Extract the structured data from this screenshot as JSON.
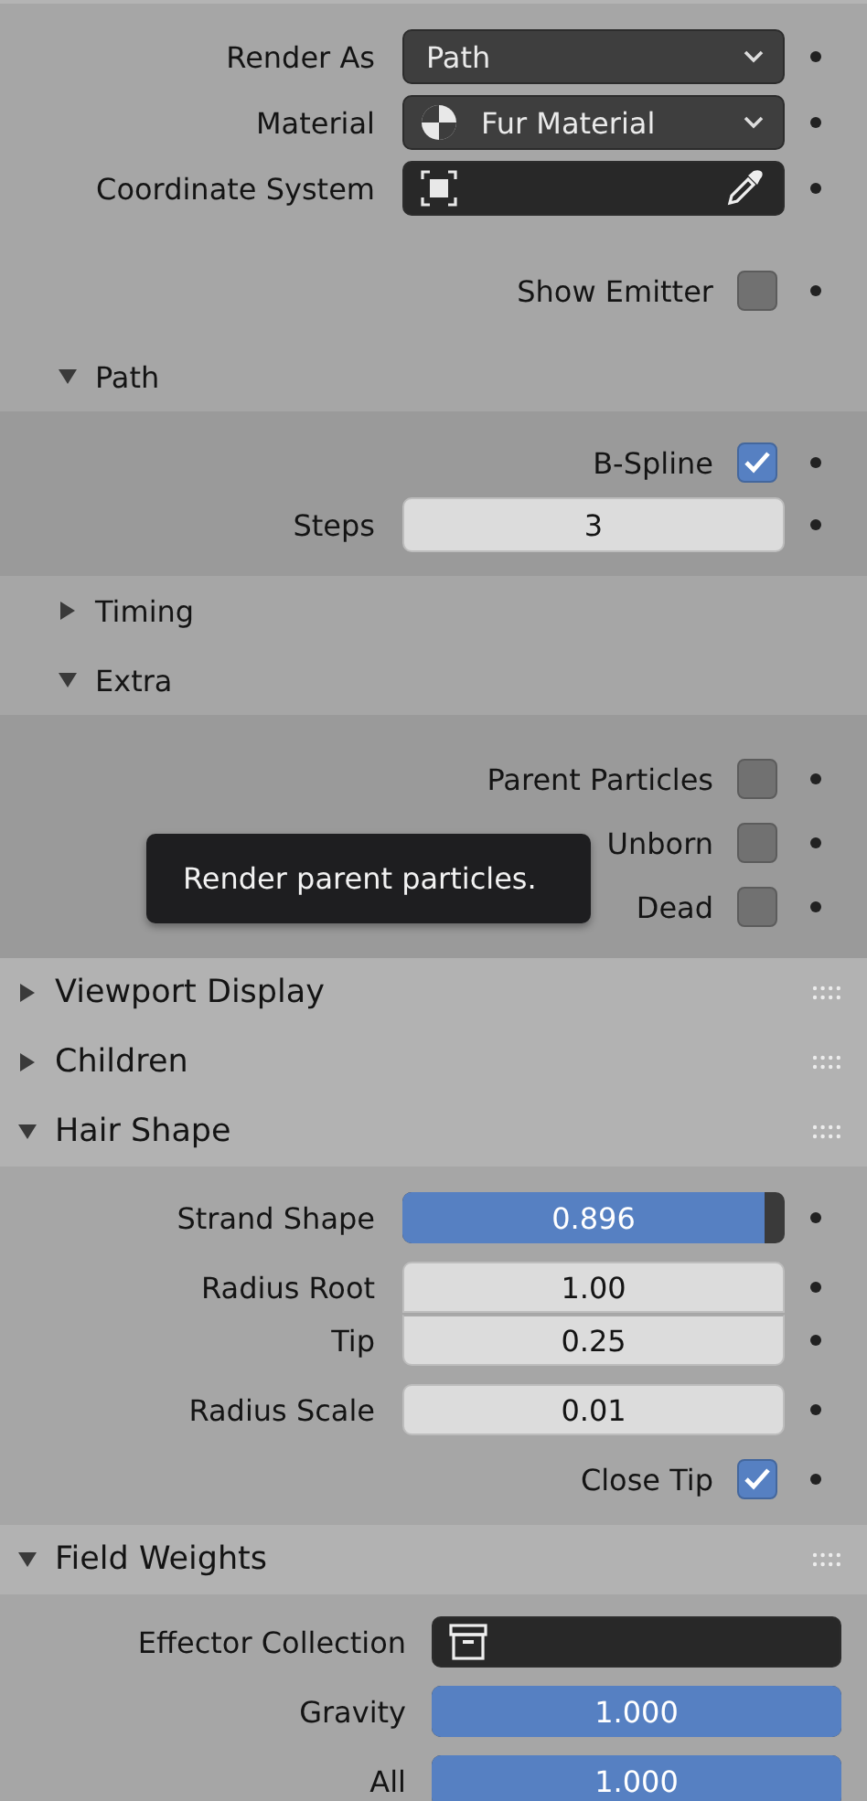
{
  "top_rows": [
    {
      "kind": "dropdown",
      "label": "Render As",
      "value": "Path"
    },
    {
      "kind": "material_dropdown",
      "label": "Material",
      "value": "Fur Material"
    },
    {
      "kind": "object_field",
      "label": "Coordinate System"
    }
  ],
  "show_emitter": {
    "kind": "checkbox",
    "label": "Show Emitter",
    "checked": false
  },
  "subpanels": [
    {
      "title": "Path",
      "expanded": true,
      "rows": [
        {
          "kind": "checkbox",
          "label": "B-Spline",
          "checked": true
        },
        {
          "kind": "number",
          "label": "Steps",
          "value": "3"
        }
      ]
    },
    {
      "title": "Timing",
      "expanded": false
    },
    {
      "title": "Extra",
      "expanded": true,
      "rows": [
        {
          "kind": "checkbox",
          "label": "Parent Particles",
          "checked": false
        },
        {
          "kind": "checkbox",
          "label": "Unborn",
          "checked": false
        },
        {
          "kind": "checkbox",
          "label": "Dead",
          "checked": false
        }
      ]
    }
  ],
  "tooltip": {
    "text": "Render parent particles."
  },
  "panels": [
    {
      "title": "Viewport Display",
      "expanded": false
    },
    {
      "title": "Children",
      "expanded": false
    },
    {
      "title": "Hair Shape",
      "expanded": true,
      "groups": [
        [
          {
            "kind": "slider",
            "label": "Strand Shape",
            "value": "0.896",
            "level": 0.948
          }
        ],
        [
          {
            "kind": "number",
            "label": "Radius Root",
            "value": "1.00"
          },
          {
            "kind": "number",
            "label": "Tip",
            "value": "0.25"
          }
        ],
        [
          {
            "kind": "number",
            "label": "Radius Scale",
            "value": "0.01"
          }
        ],
        [
          {
            "kind": "checkbox",
            "label": "Close Tip",
            "checked": true
          }
        ]
      ]
    },
    {
      "title": "Field Weights",
      "expanded": true,
      "groups": [
        [
          {
            "kind": "collection_field",
            "label": "Effector Collection"
          }
        ],
        [
          {
            "kind": "slider",
            "label": "Gravity",
            "value": "1.000",
            "level": 1
          }
        ],
        [
          {
            "kind": "slider",
            "label": "All",
            "value": "1.000",
            "level": 1
          }
        ]
      ]
    }
  ]
}
